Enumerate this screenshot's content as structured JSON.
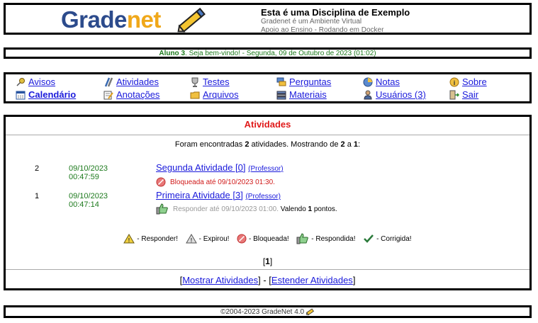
{
  "header": {
    "logo_part1": "Grade",
    "logo_part2": "net",
    "title": "Esta é uma Disciplina de Exemplo",
    "subtitle1": "Gradenet é um Ambiente Virtual",
    "subtitle2": "Apoio ao Ensino - Rodando em Docker"
  },
  "welcome": {
    "user": "Aluno 3",
    "message": ". Seja bem-vindo! - Segunda, 09 de Outubro de 2023 (01:02)"
  },
  "nav": {
    "avisos": "Avisos",
    "calendario": "Calendário",
    "atividades": "Atividades",
    "anotacoes": "Anotações",
    "testes": "Testes",
    "arquivos": "Arquivos",
    "perguntas": "Perguntas",
    "materiais": "Materiais",
    "notas": "Notas",
    "usuarios": "Usuários (3)",
    "sobre": "Sobre",
    "sair": "Sair"
  },
  "main": {
    "heading": "Atividades",
    "found_prefix": "Foram encontradas ",
    "found_count": "2",
    "found_mid": " atividades. Mostrando de ",
    "found_from": "2",
    "found_a": " a ",
    "found_to": "1",
    "found_end": ":",
    "activities": [
      {
        "num": "2",
        "date": "09/10/2023 00:47:59",
        "title": "Segunda Atividade [0]",
        "author": "(Professor)",
        "status": "Bloqueada até 09/10/2023 01:30."
      },
      {
        "num": "1",
        "date": "09/10/2023 00:47:14",
        "title": "Primeira Atividade [3]",
        "author": "(Professor)",
        "status": "Responder até 09/10/2023 01:00.",
        "value_prefix": " Valendo ",
        "value_points": "1",
        "value_suffix": " pontos."
      }
    ],
    "legend": {
      "responder": "- Responder!",
      "expirou": "- Expirou!",
      "bloqueada": "- Bloqueada!",
      "respondida": "- Respondida!",
      "corrigida": "- Corrigida!"
    },
    "pager_open": "[",
    "pager_page": "1",
    "pager_close": "]",
    "show_link": "Mostrar Atividades",
    "extend_link": "Estender Atividades",
    "bracket_open": "[",
    "separator": "] - [",
    "bracket_close": "]"
  },
  "footer": {
    "text": "©2004-2023 GradeNet 4.0"
  },
  "colors": {
    "welcome_green": "#1d7a1d",
    "heading_red": "#e01a1a",
    "link_blue": "#1a1adb",
    "logo_blue": "#2c4b8c",
    "logo_orange": "#f0a81a"
  },
  "icons": {
    "avisos": "pin-icon",
    "calendario": "calendar-icon",
    "atividades": "pencils-icon",
    "anotacoes": "notepad-icon",
    "testes": "trophy-icon",
    "arquivos": "folder-icon",
    "perguntas": "chat-icon",
    "materiais": "books-icon",
    "notas": "pie-icon",
    "usuarios": "user-icon",
    "sobre": "info-icon",
    "sair": "exit-icon"
  }
}
